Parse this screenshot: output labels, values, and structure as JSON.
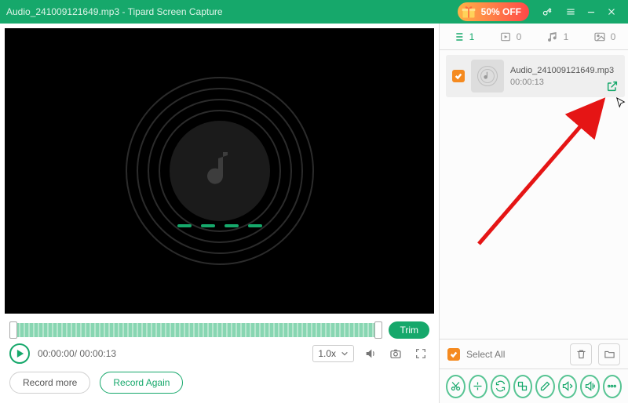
{
  "titlebar": {
    "file": "Audio_241009121649.mp3",
    "sep": "  -  ",
    "app": "Tipard Screen Capture",
    "promo": "50% OFF"
  },
  "timeline": {
    "trim": "Trim"
  },
  "controls": {
    "time": "00:00:00/ 00:00:13",
    "speed": "1.0x"
  },
  "bottom": {
    "record_more": "Record more",
    "record_again": "Record Again"
  },
  "tabs": {
    "list_count": "1",
    "video_count": "0",
    "audio_count": "1",
    "image_count": "0"
  },
  "item": {
    "name": "Audio_241009121649.mp3",
    "duration": "00:00:13"
  },
  "rfoot": {
    "select_all": "Select All"
  }
}
